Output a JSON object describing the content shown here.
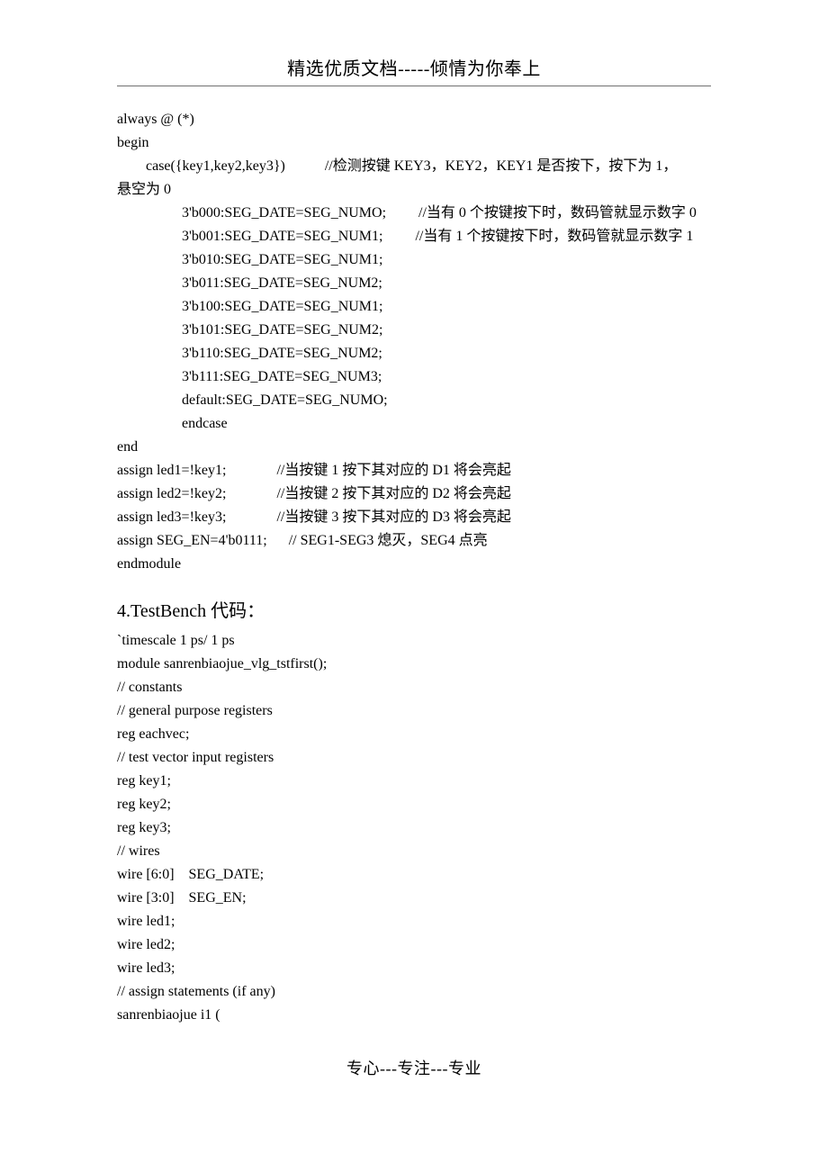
{
  "header": "精选优质文档-----倾情为你奉上",
  "lines": [
    "always @ (*)",
    "begin",
    "        case({key1,key2,key3})           //检测按键 KEY3，KEY2，KEY1 是否按下，按下为 1，",
    "悬空为 0",
    "                  3'b000:SEG_DATE=SEG_NUMO;         //当有 0 个按键按下时，数码管就显示数字 0",
    "                  3'b001:SEG_DATE=SEG_NUM1;         //当有 1 个按键按下时，数码管就显示数字 1",
    "                  3'b010:SEG_DATE=SEG_NUM1;",
    "                  3'b011:SEG_DATE=SEG_NUM2;",
    "                  3'b100:SEG_DATE=SEG_NUM1;",
    "                  3'b101:SEG_DATE=SEG_NUM2;",
    "                  3'b110:SEG_DATE=SEG_NUM2;",
    "                  3'b111:SEG_DATE=SEG_NUM3;",
    "                  default:SEG_DATE=SEG_NUMO;",
    "                  endcase",
    "end",
    "",
    "assign led1=!key1;              //当按键 1 按下其对应的 D1 将会亮起",
    "assign led2=!key2;              //当按键 2 按下其对应的 D2 将会亮起",
    "assign led3=!key3;              //当按键 3 按下其对应的 D3 将会亮起",
    "assign SEG_EN=4'b0111;      // SEG1-SEG3 熄灭，SEG4 点亮",
    "",
    "",
    "endmodule"
  ],
  "section_title": "4.TestBench 代码：",
  "lines2": [
    "`timescale 1 ps/ 1 ps",
    "module sanrenbiaojue_vlg_tstfirst();",
    "// constants",
    "// general purpose registers",
    "reg eachvec;",
    "// test vector input registers",
    "reg key1;",
    "reg key2;",
    "reg key3;",
    "// wires",
    "wire [6:0]    SEG_DATE;",
    "wire [3:0]    SEG_EN;",
    "wire led1;",
    "wire led2;",
    "wire led3;",
    "",
    "// assign statements (if any)",
    "sanrenbiaojue i1 ("
  ],
  "footer": "专心---专注---专业"
}
